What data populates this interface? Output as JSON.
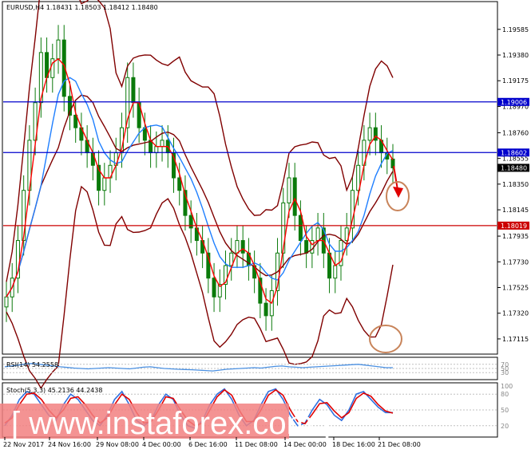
{
  "chart_data": [
    {
      "type": "candlestick",
      "panel": "main",
      "header": "EURUSD,H4  1.18431 1.18503 1.18412 1.18480",
      "ylim": [
        1.17,
        1.198
      ],
      "price_ticks": [
        "1.19585",
        "1.19380",
        "1.19175",
        "1.18970",
        "1.18760",
        "1.18555",
        "1.18350",
        "1.18145",
        "1.17935",
        "1.17730",
        "1.17525",
        "1.17320",
        "1.17115"
      ],
      "levels": [
        {
          "label": "1.19006",
          "value": 1.19006,
          "color": "#0000cc"
        },
        {
          "label": "1.18602",
          "value": 1.18602,
          "color": "#0000cc"
        },
        {
          "label": "1.18019",
          "value": 1.18019,
          "color": "#cc0000"
        }
      ],
      "current_price": {
        "label": "1.18480",
        "value": 1.1848
      },
      "x_labels": [
        "22 Nov 2017",
        "24 Nov 16:00",
        "29 Nov 08:00",
        "4 Dec 00:00",
        "6 Dec 16:00",
        "11 Dec 08:00",
        "14 Dec 00:00",
        "18 Dec 16:00",
        "21 Dec 08:00"
      ],
      "close_path": [
        1.1745,
        1.176,
        1.179,
        1.183,
        1.187,
        1.19,
        1.194,
        1.192,
        1.1935,
        1.195,
        1.1905,
        1.189,
        1.188,
        1.187,
        1.186,
        1.185,
        1.183,
        1.184,
        1.185,
        1.186,
        1.188,
        1.192,
        1.19,
        1.188,
        1.187,
        1.186,
        1.1865,
        1.187,
        1.186,
        1.184,
        1.183,
        1.181,
        1.18,
        1.179,
        1.178,
        1.176,
        1.1745,
        1.1755,
        1.177,
        1.178,
        1.179,
        1.178,
        1.177,
        1.176,
        1.174,
        1.173,
        1.175,
        1.178,
        1.182,
        1.184,
        1.181,
        1.179,
        1.178,
        1.179,
        1.18,
        1.178,
        1.176,
        1.177,
        1.179,
        1.18,
        1.183,
        1.185,
        1.187,
        1.188,
        1.187,
        1.186,
        1.1855,
        1.1848
      ]
    },
    {
      "type": "line",
      "panel": "rsi",
      "header": "RSI(14) 54.2558",
      "ylim": [
        0,
        100
      ],
      "levels": [
        70,
        50,
        30
      ],
      "values": [
        58,
        62,
        66,
        72,
        74,
        70,
        66,
        62,
        58,
        55,
        52,
        50,
        48,
        50,
        52,
        54,
        52,
        50,
        48,
        52,
        56,
        58,
        54,
        50,
        48,
        46,
        45,
        44,
        42,
        40,
        38,
        42,
        46,
        48,
        50,
        52,
        54,
        52,
        56,
        60,
        62,
        58,
        56,
        54,
        56,
        58,
        60,
        62,
        64,
        66,
        68,
        70,
        66,
        62,
        58,
        54,
        54
      ]
    },
    {
      "type": "line",
      "panel": "stoch",
      "header": "Stoch(5,3,3) 45.2136 44.2438",
      "ylim": [
        0,
        100
      ],
      "levels": [
        80,
        50,
        20
      ],
      "series": [
        {
          "values": [
            20,
            40,
            70,
            85,
            80,
            60,
            40,
            30,
            60,
            80,
            70,
            50,
            30,
            20,
            40,
            70,
            85,
            60,
            30,
            20,
            30,
            60,
            80,
            70,
            40,
            20,
            15,
            30,
            60,
            80,
            90,
            70,
            40,
            20,
            30,
            60,
            85,
            90,
            70,
            40,
            20,
            25,
            50,
            70,
            60,
            40,
            30,
            50,
            80,
            85,
            70,
            55,
            45,
            45
          ]
        },
        {
          "values": [
            25,
            35,
            60,
            80,
            82,
            70,
            50,
            35,
            50,
            72,
            75,
            60,
            40,
            25,
            35,
            60,
            80,
            70,
            45,
            25,
            28,
            50,
            75,
            72,
            50,
            30,
            20,
            25,
            50,
            75,
            88,
            78,
            50,
            28,
            28,
            50,
            78,
            88,
            78,
            50,
            28,
            24,
            42,
            62,
            64,
            48,
            35,
            45,
            72,
            82,
            76,
            60,
            48,
            44
          ]
        }
      ]
    }
  ],
  "watermark": "[ www.instaforex.com ]",
  "colors": {
    "candle": "#0a7a0a",
    "ma_fast": "#ff0000",
    "ma_slow": "#1f7fff",
    "bands": "#800000",
    "level_blue": "#0000cc",
    "level_red": "#cc0000",
    "rsi_line": "#4a90e2",
    "circle": "#c8845a",
    "watermark_band": "#f28080"
  },
  "icons": {
    "arrow": "red-down-arrow-icon",
    "circles": "highlight-circle-icon"
  }
}
